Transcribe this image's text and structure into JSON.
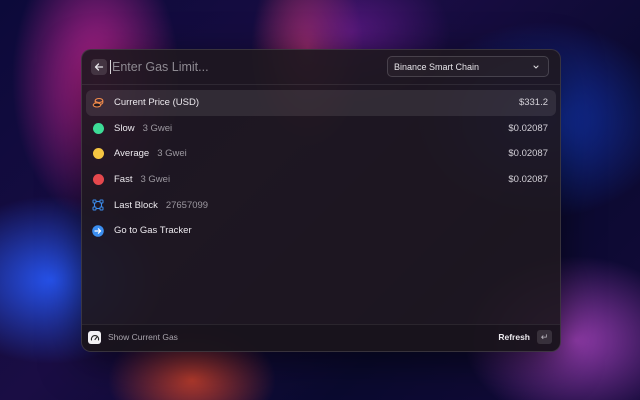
{
  "search": {
    "placeholder": "Enter Gas Limit..."
  },
  "network": {
    "selected": "Binance Smart Chain"
  },
  "items": [
    {
      "title": "Current Price (USD)",
      "subtitle": "",
      "accessory": "$331.2",
      "icon": "coins-icon",
      "color": "#f08a4b"
    },
    {
      "title": "Slow",
      "subtitle": "3 Gwei",
      "accessory": "$0.02087",
      "icon": "circle-icon",
      "color": "#3ddc97"
    },
    {
      "title": "Average",
      "subtitle": "3 Gwei",
      "accessory": "$0.02087",
      "icon": "circle-icon",
      "color": "#f5c542"
    },
    {
      "title": "Fast",
      "subtitle": "3 Gwei",
      "accessory": "$0.02087",
      "icon": "circle-icon",
      "color": "#e5484d"
    },
    {
      "title": "Last Block",
      "subtitle": "27657099",
      "accessory": "",
      "icon": "block-icon",
      "color": "#3b8ef0"
    },
    {
      "title": "Go to Gas Tracker",
      "subtitle": "",
      "accessory": "",
      "icon": "arrow-right-circle-icon",
      "color": "#3b8ef0"
    }
  ],
  "footer": {
    "label": "Show Current Gas",
    "action": "Refresh",
    "enter_glyph": "↵"
  }
}
